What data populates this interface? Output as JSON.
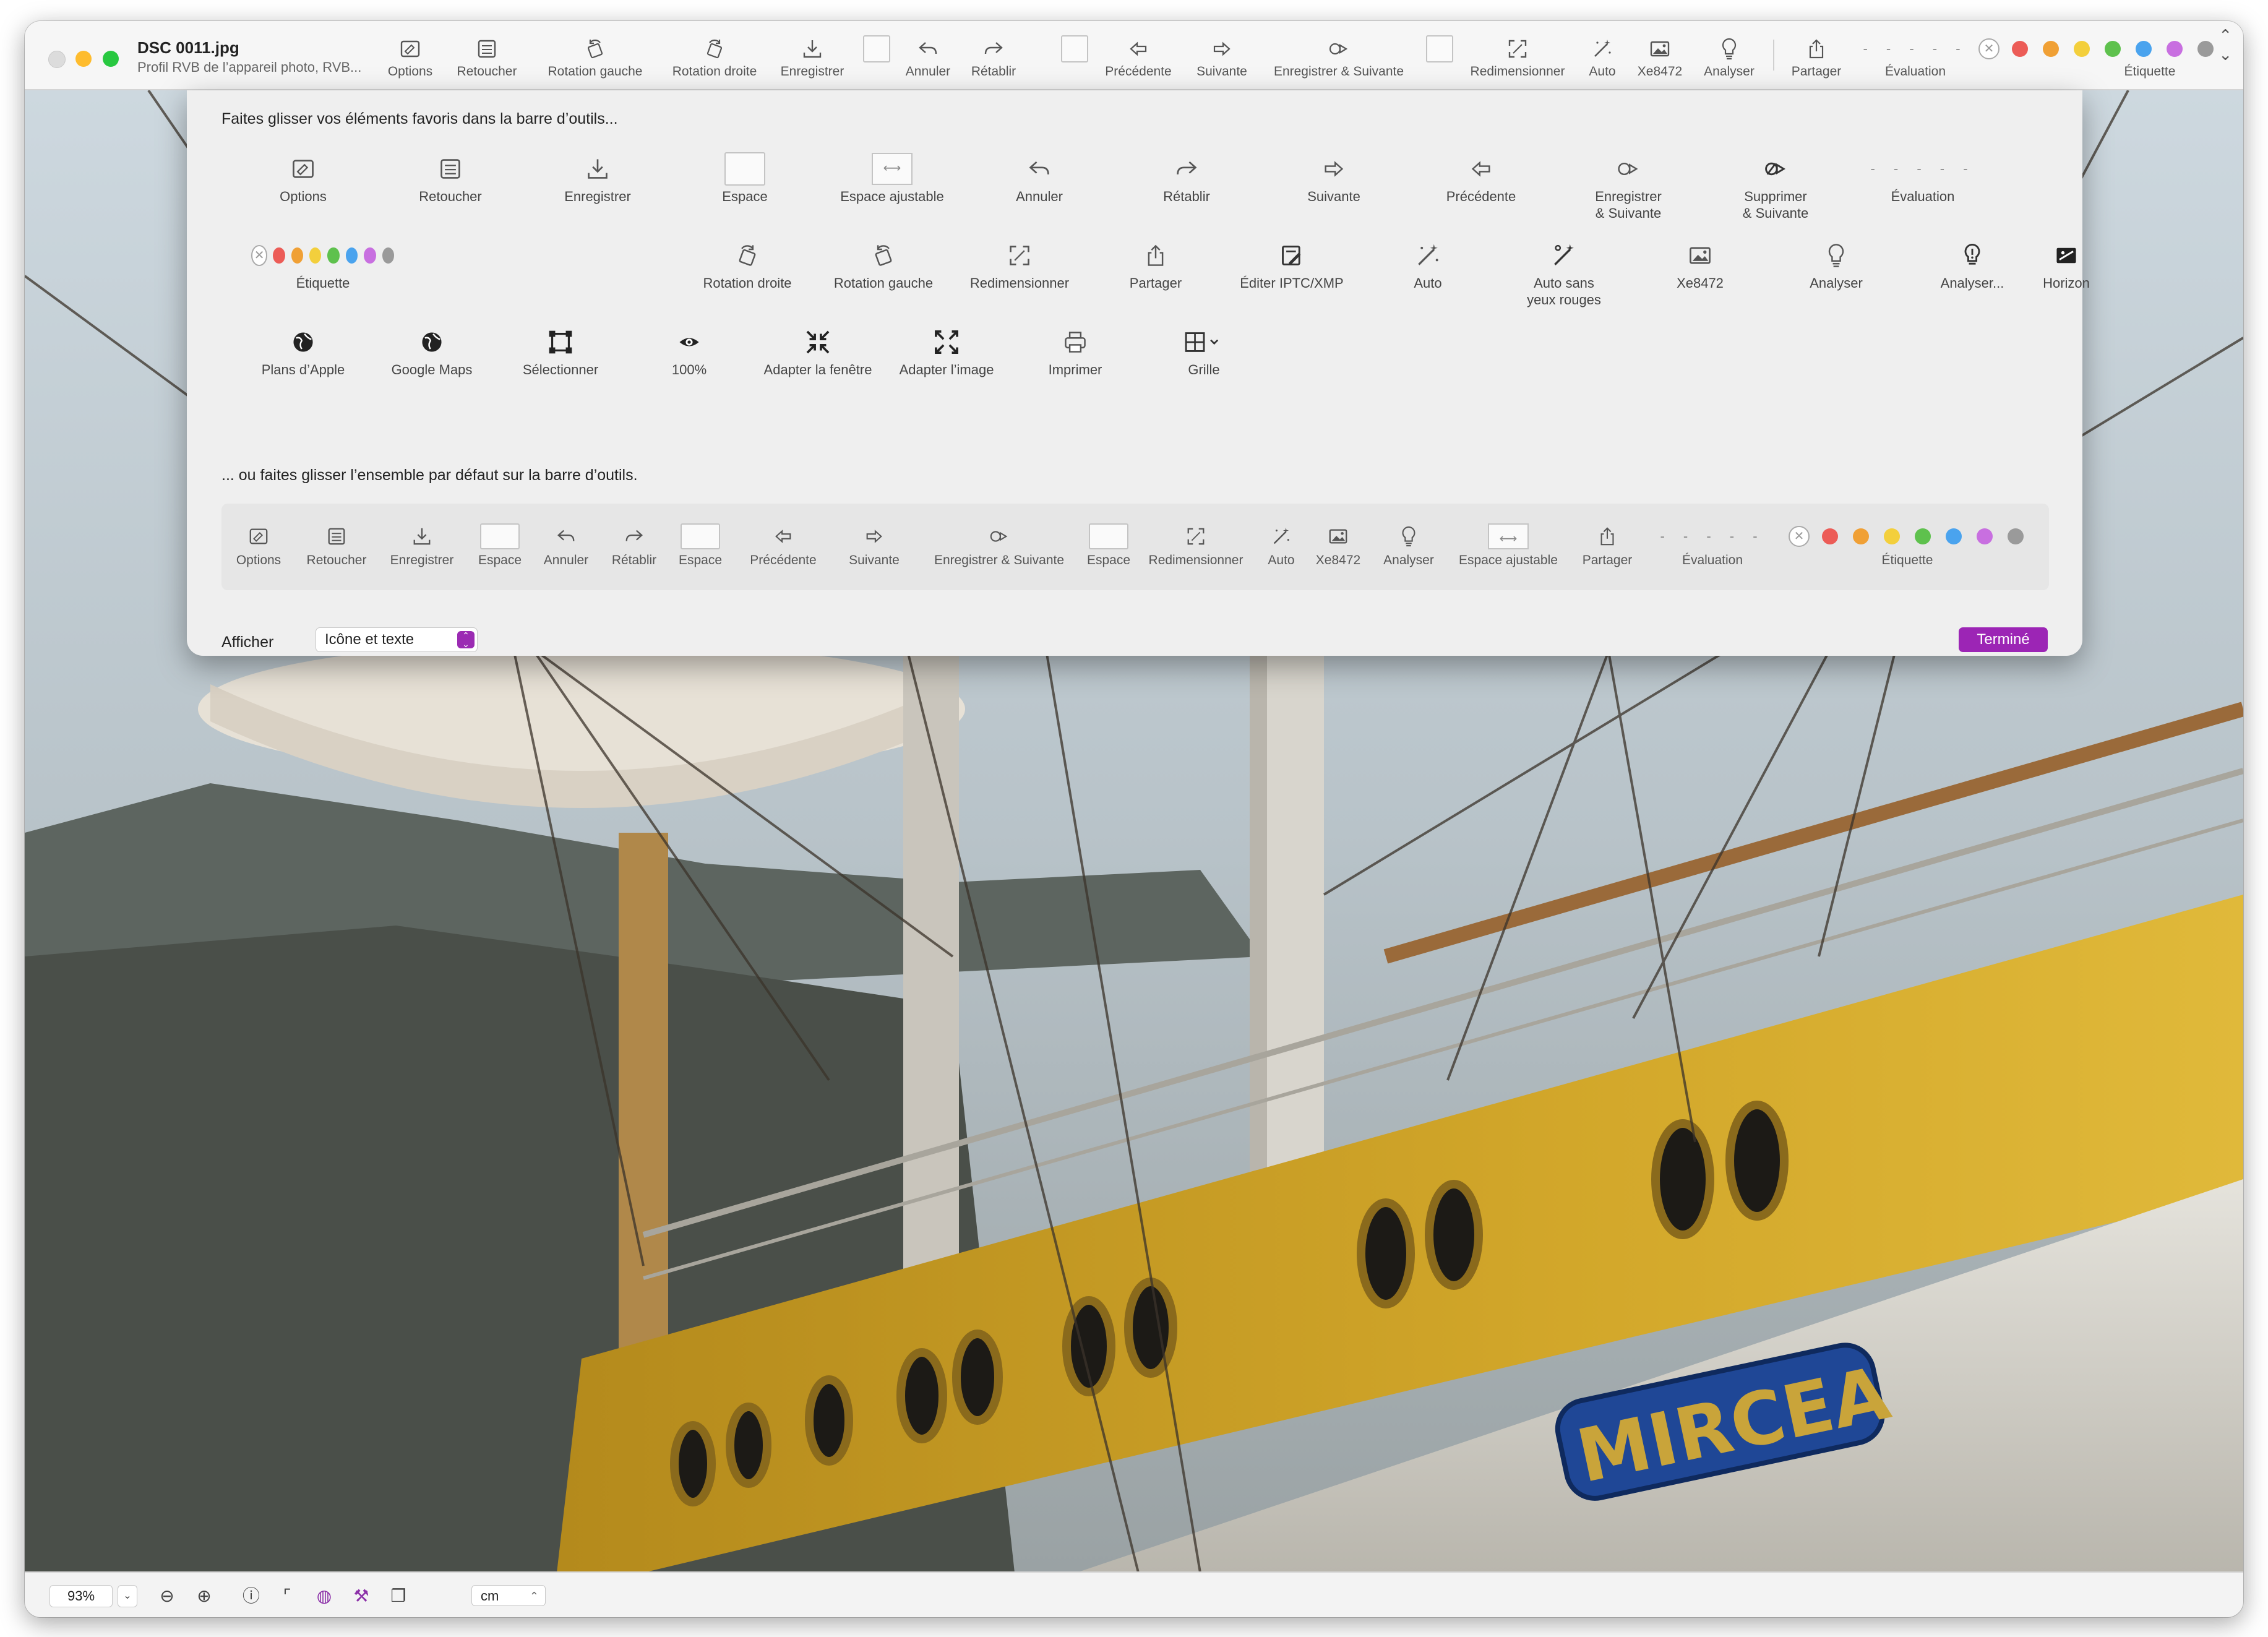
{
  "window": {
    "title": "DSC 0011.jpg",
    "subtitle": "Profil RVB de l’appareil photo, RVB..."
  },
  "toolbar": {
    "items": [
      {
        "label": "Options",
        "icon": "options-icon"
      },
      {
        "label": "Retoucher",
        "icon": "retouch-icon"
      },
      {
        "label": "Rotation gauche",
        "icon": "rotate-left-icon"
      },
      {
        "label": "Rotation droite",
        "icon": "rotate-right-icon"
      },
      {
        "label": "Enregistrer",
        "icon": "save-icon"
      },
      {
        "label": "Annuler",
        "icon": "undo-icon"
      },
      {
        "label": "Rétablir",
        "icon": "redo-icon"
      },
      {
        "label": "Précédente",
        "icon": "previous-icon"
      },
      {
        "label": "Suivante",
        "icon": "next-icon"
      },
      {
        "label": "Enregistrer & Suivante",
        "icon": "save-next-icon"
      },
      {
        "label": "Redimensionner",
        "icon": "resize-icon"
      },
      {
        "label": "Auto",
        "icon": "magic-wand-icon"
      },
      {
        "label": "Xe8472",
        "icon": "image-icon"
      },
      {
        "label": "Analyser",
        "icon": "lightbulb-icon"
      },
      {
        "label": "Partager",
        "icon": "share-icon"
      },
      {
        "label": "Évaluation",
        "icon": "rating-icon"
      },
      {
        "label": "Étiquette",
        "icon": "label-icon"
      }
    ]
  },
  "label_colors": [
    "#ec5c57",
    "#f0a035",
    "#f3cf3c",
    "#5ec14d",
    "#4aa3ee",
    "#c86fe0",
    "#9a9a9a"
  ],
  "customize": {
    "heading": "Faites glisser vos éléments favoris dans la barre d’outils...",
    "palette": [
      {
        "label": "Options",
        "icon": "options-icon"
      },
      {
        "label": "Retoucher",
        "icon": "retouch-icon"
      },
      {
        "label": "Enregistrer",
        "icon": "save-icon"
      },
      {
        "label": "Espace",
        "icon": "space-icon"
      },
      {
        "label": "Espace ajustable",
        "icon": "flexible-space-icon"
      },
      {
        "label": "Annuler",
        "icon": "undo-icon"
      },
      {
        "label": "Rétablir",
        "icon": "redo-icon"
      },
      {
        "label": "Suivante",
        "icon": "next-icon"
      },
      {
        "label": "Précédente",
        "icon": "previous-icon"
      },
      {
        "label": "Enregistrer\n& Suivante",
        "icon": "save-next-icon"
      },
      {
        "label": "Supprimer\n& Suivante",
        "icon": "delete-next-icon"
      },
      {
        "label": "Évaluation",
        "icon": "rating-icon"
      },
      {
        "label": "Étiquette",
        "icon": "label-icon"
      },
      {
        "label": "Rotation droite",
        "icon": "rotate-right-icon"
      },
      {
        "label": "Rotation gauche",
        "icon": "rotate-left-icon"
      },
      {
        "label": "Redimensionner",
        "icon": "resize-icon"
      },
      {
        "label": "Partager",
        "icon": "share-icon"
      },
      {
        "label": "Éditer IPTC/XMP",
        "icon": "metadata-icon"
      },
      {
        "label": "Auto",
        "icon": "magic-wand-icon"
      },
      {
        "label": "Auto sans\nyeux rouges",
        "icon": "magic-wand-redeye-icon"
      },
      {
        "label": "Xe8472",
        "icon": "image-icon"
      },
      {
        "label": "Analyser",
        "icon": "lightbulb-icon"
      },
      {
        "label": "Analyser...",
        "icon": "lightbulb-alert-icon"
      },
      {
        "label": "Horizon",
        "icon": "horizon-icon"
      },
      {
        "label": "Plans d’Apple",
        "icon": "globe-icon"
      },
      {
        "label": "Google Maps",
        "icon": "globe-icon"
      },
      {
        "label": "Sélectionner",
        "icon": "select-icon"
      },
      {
        "label": "100%",
        "icon": "eye-icon"
      },
      {
        "label": "Adapter la fenêtre",
        "icon": "fit-window-icon"
      },
      {
        "label": "Adapter l’image",
        "icon": "fit-image-icon"
      },
      {
        "label": "Imprimer",
        "icon": "print-icon"
      },
      {
        "label": "Grille",
        "icon": "grid-icon"
      }
    ],
    "default_heading": "... ou faites glisser l’ensemble par défaut sur la barre d’outils.",
    "default_set": [
      {
        "label": "Options",
        "icon": "options-icon"
      },
      {
        "label": "Retoucher",
        "icon": "retouch-icon"
      },
      {
        "label": "Enregistrer",
        "icon": "save-icon"
      },
      {
        "label": "Espace",
        "icon": "space-icon"
      },
      {
        "label": "Annuler",
        "icon": "undo-icon"
      },
      {
        "label": "Rétablir",
        "icon": "redo-icon"
      },
      {
        "label": "Espace",
        "icon": "space-icon"
      },
      {
        "label": "Précédente",
        "icon": "previous-icon"
      },
      {
        "label": "Suivante",
        "icon": "next-icon"
      },
      {
        "label": "Enregistrer & Suivante",
        "icon": "save-next-icon"
      },
      {
        "label": "Espace",
        "icon": "space-icon"
      },
      {
        "label": "Redimensionner",
        "icon": "resize-icon"
      },
      {
        "label": "Auto",
        "icon": "magic-wand-icon"
      },
      {
        "label": "Xe8472",
        "icon": "image-icon"
      },
      {
        "label": "Analyser",
        "icon": "lightbulb-icon"
      },
      {
        "label": "Espace ajustable",
        "icon": "flexible-space-icon"
      },
      {
        "label": "Partager",
        "icon": "share-icon"
      },
      {
        "label": "Évaluation",
        "icon": "rating-icon"
      },
      {
        "label": "Étiquette",
        "icon": "label-icon"
      }
    ],
    "show_label": "Afficher",
    "show_value": "Icône et texte",
    "done_label": "Terminé",
    "accent": "#9c25b5"
  },
  "photo": {
    "ship_name": "MIRCEA"
  },
  "statusbar": {
    "zoom": "93%",
    "unit": "cm"
  }
}
